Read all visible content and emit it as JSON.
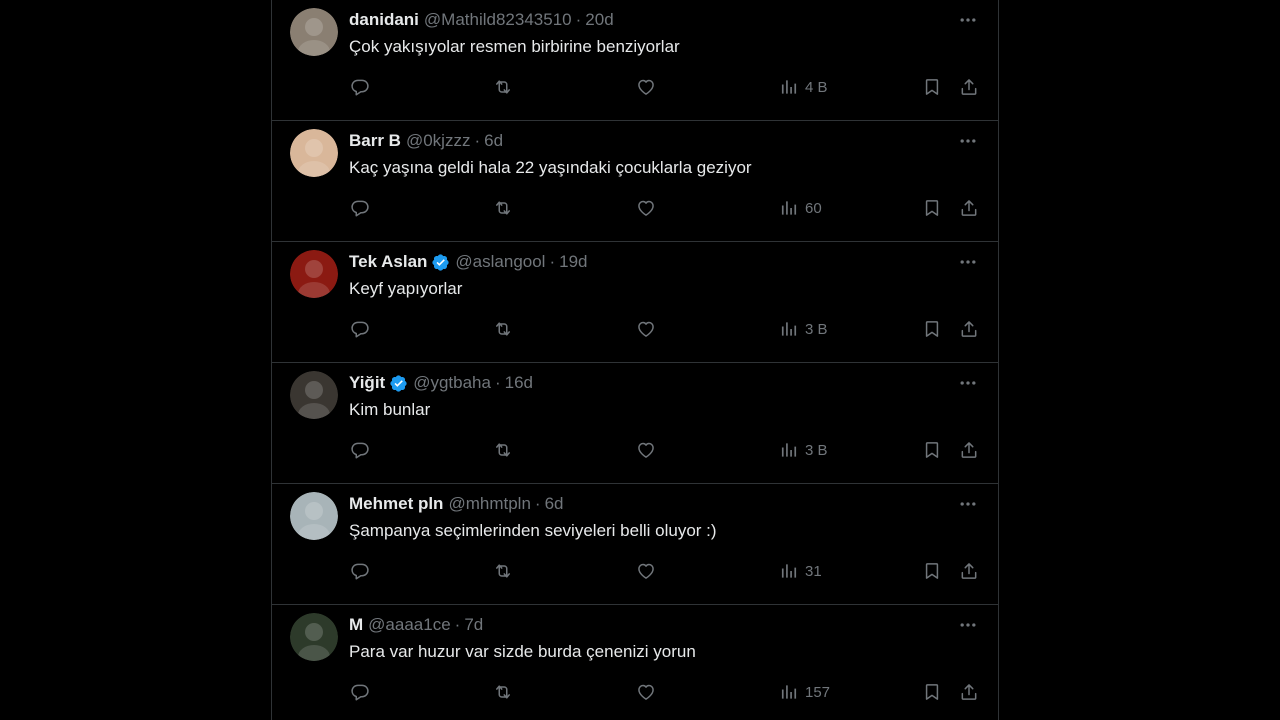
{
  "replies": [
    {
      "name": "danidani",
      "verified": false,
      "handle": "@Mathild82343510",
      "separator": "·",
      "time": "20d",
      "text": "Çok yakışıyolar resmen birbirine benziyorlar",
      "views": "4 B",
      "avatar_color": "#8a7f72"
    },
    {
      "name": "Barr B",
      "verified": false,
      "handle": "@0kjzzz",
      "separator": "·",
      "time": "6d",
      "text": "Kaç yaşına geldi hala 22 yaşındaki çocuklarla geziyor",
      "views": "60",
      "avatar_color": "#d9b79a"
    },
    {
      "name": "Tek Aslan",
      "verified": true,
      "handle": "@aslangool",
      "separator": "·",
      "time": "19d",
      "text": "Keyf yapıyorlar",
      "views": "3 B",
      "avatar_color": "#8b1a12"
    },
    {
      "name": "Yiğit",
      "verified": true,
      "handle": "@ygtbaha",
      "separator": "·",
      "time": "16d",
      "text": "Kim bunlar",
      "views": "3 B",
      "avatar_color": "#3a3631"
    },
    {
      "name": "Mehmet pln",
      "verified": false,
      "handle": "@mhmtpln",
      "separator": "·",
      "time": "6d",
      "text": "Şampanya seçimlerinden seviyeleri belli oluyor :)",
      "views": "31",
      "avatar_color": "#a8b4b8"
    },
    {
      "name": "M",
      "verified": false,
      "handle": "@aaaa1ce",
      "separator": "·",
      "time": "7d",
      "text": "Para var huzur var sizde burda çenenizi yorun",
      "views": "157",
      "avatar_color": "#2d3a2a"
    }
  ],
  "colors": {
    "background": "#000000",
    "border": "#2f3336",
    "text_primary": "#e7e9ea",
    "text_secondary": "#71767b",
    "verified_blue": "#1d9bf0"
  },
  "icons": [
    "reply-icon",
    "retweet-icon",
    "like-icon",
    "views-icon",
    "bookmark-icon",
    "share-icon",
    "more-icon",
    "verified-badge-icon"
  ]
}
